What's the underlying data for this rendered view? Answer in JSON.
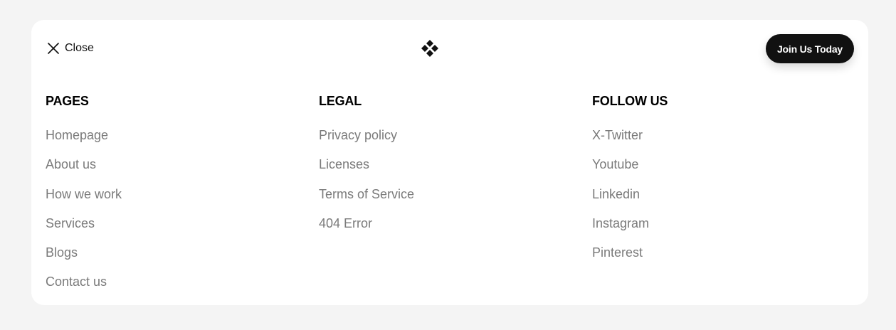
{
  "header": {
    "close_label": "Close",
    "join_label": "Join Us Today",
    "brand_color": "#111111"
  },
  "columns": {
    "pages": {
      "title": "PAGES",
      "items": [
        "Homepage",
        "About us",
        "How we work",
        "Services",
        "Blogs",
        "Contact us"
      ]
    },
    "legal": {
      "title": "LEGAL",
      "items": [
        "Privacy policy",
        "Licenses",
        "Terms of Service",
        "404 Error"
      ]
    },
    "follow": {
      "title": "FOLLOW US",
      "items": [
        "X-Twitter",
        "Youtube",
        "Linkedin",
        "Instagram",
        "Pinterest"
      ]
    }
  },
  "icons": {
    "close": "close-icon",
    "logo": "diamond-logo-icon"
  }
}
